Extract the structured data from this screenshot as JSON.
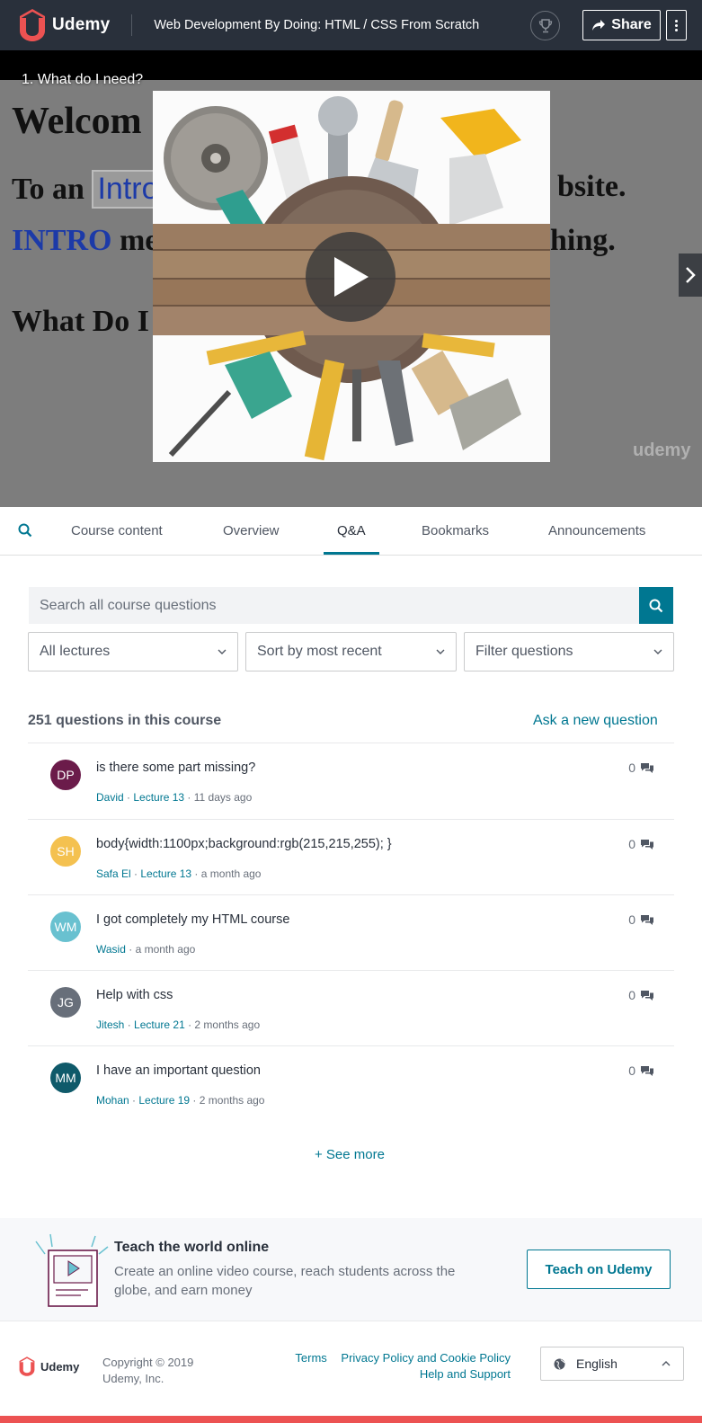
{
  "header": {
    "logo_text": "Udemy",
    "course_title": "Web Development By Doing: HTML / CSS From Scratch",
    "share_label": "Share"
  },
  "video": {
    "lecture_title": "1. What do I need?",
    "slide_line1": "Welcom",
    "slide_line2_start": "To an",
    "slide_line2_boxed": "Intro",
    "slide_line2_end": "bsite.",
    "slide_line3_blue": "INTRO",
    "slide_line3_rest": "me",
    "slide_line3_end": "hing.",
    "slide_line4": "What Do I",
    "watermark": "udemy"
  },
  "tabs": [
    {
      "label": "Course content"
    },
    {
      "label": "Overview"
    },
    {
      "label": "Q&A"
    },
    {
      "label": "Bookmarks"
    },
    {
      "label": "Announcements"
    }
  ],
  "qa": {
    "search_placeholder": "Search all course questions",
    "filters": [
      {
        "label": "All lectures"
      },
      {
        "label": "Sort by most recent"
      },
      {
        "label": "Filter questions"
      }
    ],
    "count_label": "251 questions in this course",
    "ask_label": "Ask a new question",
    "questions": [
      {
        "initials": "DP",
        "color": "#6b1b4a",
        "title": "is there some part missing?",
        "author": "David",
        "lecture": "Lecture 13",
        "time": "11 days ago",
        "replies": "0"
      },
      {
        "initials": "SH",
        "color": "#f4c150",
        "title": "body{width:1100px;background:rgb(215,215,255); }",
        "author": "Safa El",
        "lecture": "Lecture 13",
        "time": "a month ago",
        "replies": "0"
      },
      {
        "initials": "WM",
        "color": "#69c1d0",
        "title": "I got completely my HTML course",
        "author": "Wasid",
        "lecture": "",
        "time": "a month ago",
        "replies": "0"
      },
      {
        "initials": "JG",
        "color": "#686f7a",
        "title": "Help with css",
        "author": "Jitesh",
        "lecture": "Lecture 21",
        "time": "2 months ago",
        "replies": "0"
      },
      {
        "initials": "MM",
        "color": "#0f5a6a",
        "title": "I have an important question",
        "author": "Mohan",
        "lecture": "Lecture 19",
        "time": "2 months ago",
        "replies": "0"
      }
    ],
    "see_more": "+ See more"
  },
  "teach": {
    "title": "Teach the world online",
    "description": "Create an online video course, reach students across the globe, and earn money",
    "button": "Teach on Udemy"
  },
  "footer": {
    "logo_text": "Udemy",
    "copyright_line1": "Copyright © 2019",
    "copyright_line2": "Udemy, Inc.",
    "link_terms": "Terms",
    "link_privacy": "Privacy Policy and Cookie Policy",
    "link_help": "Help and Support",
    "language": "English"
  },
  "colors": {
    "brand": "#ec5252",
    "accent": "#007791",
    "header_bg": "#29303b"
  }
}
